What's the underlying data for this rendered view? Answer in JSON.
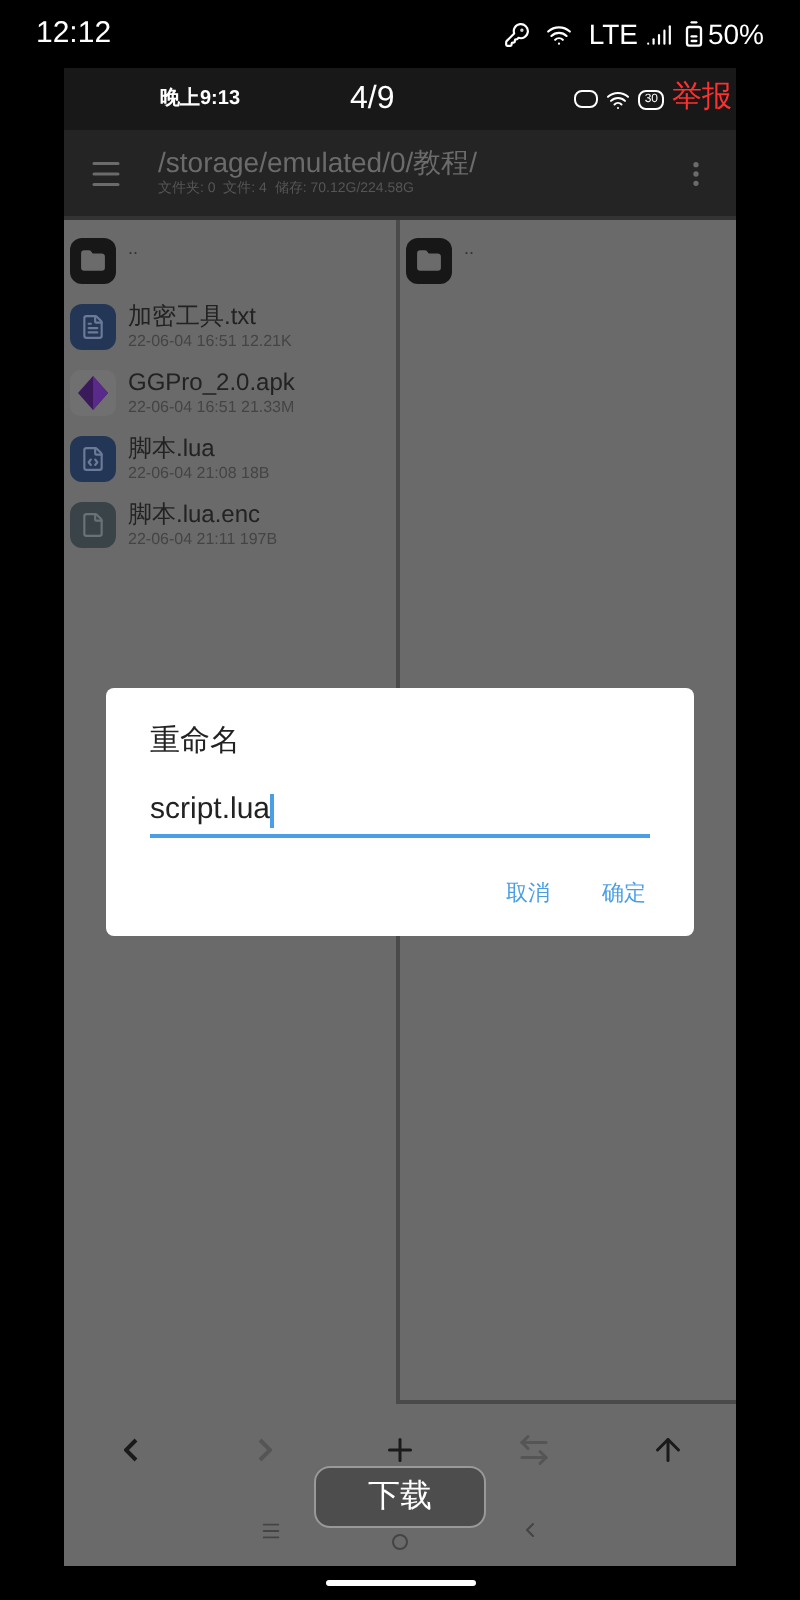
{
  "status_bar": {
    "time": "12:12",
    "network": "LTE",
    "battery": "50%"
  },
  "viewer": {
    "time": "晚上9:13",
    "counter": "4/9",
    "battery": "30",
    "report": "举报"
  },
  "file_manager": {
    "path": "/storage/emulated/0/教程/",
    "stats": "文件夹: 0  文件: 4  储存: 70.12G/224.58G",
    "left_panel": [
      {
        "kind": "folder",
        "name": ".."
      },
      {
        "kind": "text",
        "name": "加密工具.txt",
        "meta": "22-06-04 16:51  12.21K"
      },
      {
        "kind": "app",
        "name": "GGPro_2.0.apk",
        "meta": "22-06-04 16:51  21.33M"
      },
      {
        "kind": "code",
        "name": "脚本.lua",
        "meta": "22-06-04 21:08  18B"
      },
      {
        "kind": "file",
        "name": "脚本.lua.enc",
        "meta": "22-06-04 21:11  197B"
      }
    ],
    "right_panel": [
      {
        "kind": "folder",
        "name": ".."
      }
    ],
    "toolbar": [
      {
        "kind": "back",
        "disabled": false
      },
      {
        "kind": "forward",
        "disabled": true
      },
      {
        "kind": "add",
        "disabled": false
      },
      {
        "kind": "swap",
        "disabled": true
      },
      {
        "kind": "up",
        "disabled": false
      }
    ]
  },
  "dialog": {
    "title": "重命名",
    "value": "script.lua",
    "buttons": [
      "取消",
      "确定"
    ]
  },
  "download_button": "下载"
}
